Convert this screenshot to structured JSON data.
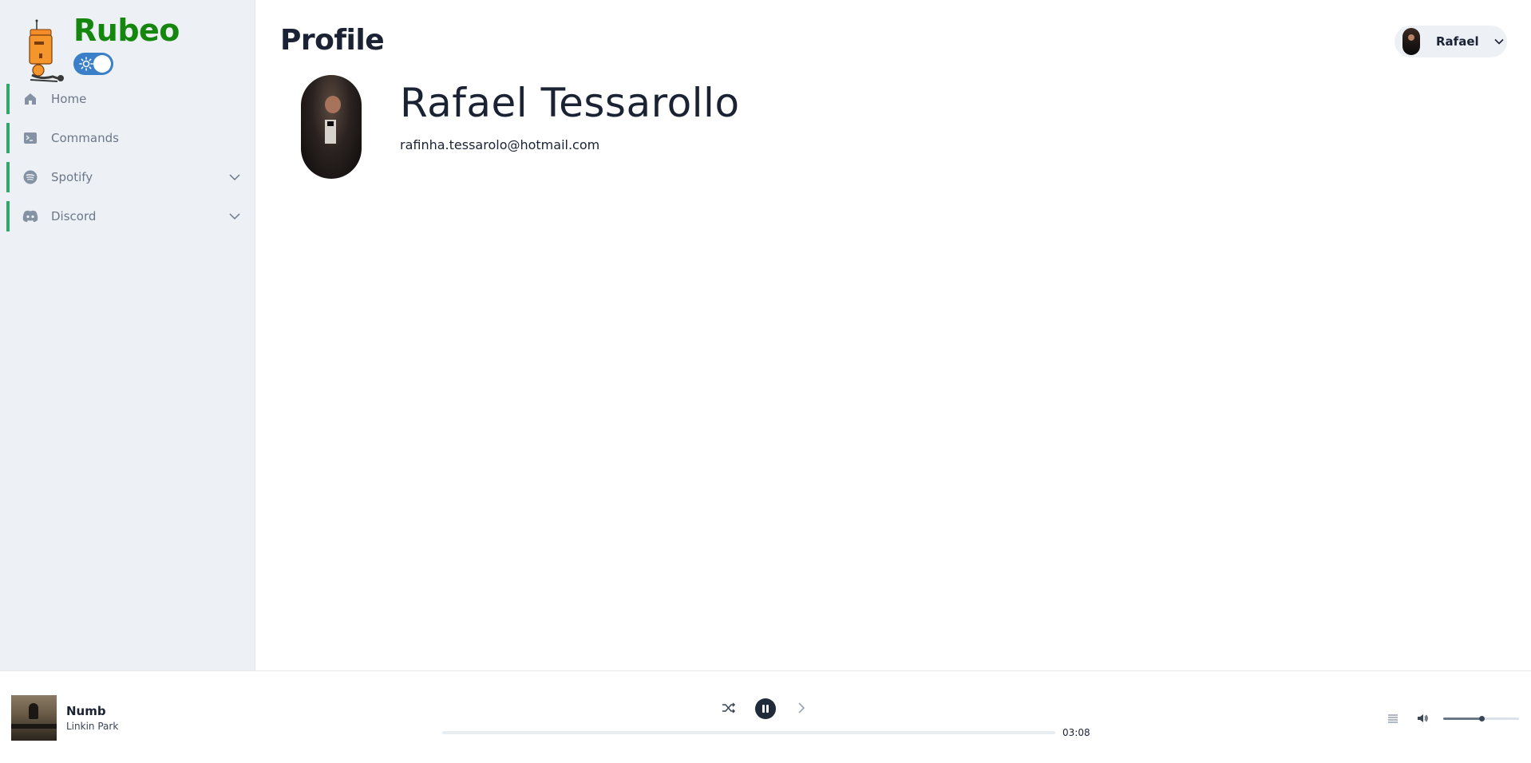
{
  "brand": {
    "name": "Rubeo"
  },
  "theme_toggle": {
    "mode": "light",
    "accent": "#3a7fc7"
  },
  "sidebar": {
    "items": [
      {
        "label": "Home",
        "icon": "home-icon",
        "expandable": false
      },
      {
        "label": "Commands",
        "icon": "terminal-icon",
        "expandable": false
      },
      {
        "label": "Spotify",
        "icon": "spotify-icon",
        "expandable": true
      },
      {
        "label": "Discord",
        "icon": "discord-icon",
        "expandable": true
      }
    ],
    "accent": "#31a86b"
  },
  "page": {
    "title": "Profile"
  },
  "user_menu": {
    "name": "Rafael"
  },
  "profile": {
    "name": "Rafael Tessarollo",
    "email": "rafinha.tessarolo@hotmail.com"
  },
  "player": {
    "track_title": "Numb",
    "track_artist": "Linkin Park",
    "duration": "03:08",
    "progress_fraction": 0.0,
    "volume_fraction": 0.5,
    "state": "playing"
  },
  "colors": {
    "brand_green": "#15870f",
    "sidebar_bg": "#edf1f6",
    "text_dark": "#1a2233"
  }
}
